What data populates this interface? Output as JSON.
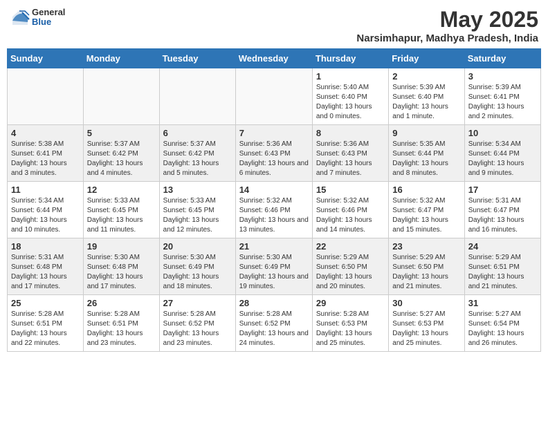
{
  "header": {
    "logo_general": "General",
    "logo_blue": "Blue",
    "month": "May 2025",
    "location": "Narsimhapur, Madhya Pradesh, India"
  },
  "weekdays": [
    "Sunday",
    "Monday",
    "Tuesday",
    "Wednesday",
    "Thursday",
    "Friday",
    "Saturday"
  ],
  "weeks": [
    [
      {
        "day": "",
        "info": ""
      },
      {
        "day": "",
        "info": ""
      },
      {
        "day": "",
        "info": ""
      },
      {
        "day": "",
        "info": ""
      },
      {
        "day": "1",
        "info": "Sunrise: 5:40 AM\nSunset: 6:40 PM\nDaylight: 13 hours and 0 minutes."
      },
      {
        "day": "2",
        "info": "Sunrise: 5:39 AM\nSunset: 6:40 PM\nDaylight: 13 hours and 1 minute."
      },
      {
        "day": "3",
        "info": "Sunrise: 5:39 AM\nSunset: 6:41 PM\nDaylight: 13 hours and 2 minutes."
      }
    ],
    [
      {
        "day": "4",
        "info": "Sunrise: 5:38 AM\nSunset: 6:41 PM\nDaylight: 13 hours and 3 minutes."
      },
      {
        "day": "5",
        "info": "Sunrise: 5:37 AM\nSunset: 6:42 PM\nDaylight: 13 hours and 4 minutes."
      },
      {
        "day": "6",
        "info": "Sunrise: 5:37 AM\nSunset: 6:42 PM\nDaylight: 13 hours and 5 minutes."
      },
      {
        "day": "7",
        "info": "Sunrise: 5:36 AM\nSunset: 6:43 PM\nDaylight: 13 hours and 6 minutes."
      },
      {
        "day": "8",
        "info": "Sunrise: 5:36 AM\nSunset: 6:43 PM\nDaylight: 13 hours and 7 minutes."
      },
      {
        "day": "9",
        "info": "Sunrise: 5:35 AM\nSunset: 6:44 PM\nDaylight: 13 hours and 8 minutes."
      },
      {
        "day": "10",
        "info": "Sunrise: 5:34 AM\nSunset: 6:44 PM\nDaylight: 13 hours and 9 minutes."
      }
    ],
    [
      {
        "day": "11",
        "info": "Sunrise: 5:34 AM\nSunset: 6:44 PM\nDaylight: 13 hours and 10 minutes."
      },
      {
        "day": "12",
        "info": "Sunrise: 5:33 AM\nSunset: 6:45 PM\nDaylight: 13 hours and 11 minutes."
      },
      {
        "day": "13",
        "info": "Sunrise: 5:33 AM\nSunset: 6:45 PM\nDaylight: 13 hours and 12 minutes."
      },
      {
        "day": "14",
        "info": "Sunrise: 5:32 AM\nSunset: 6:46 PM\nDaylight: 13 hours and 13 minutes."
      },
      {
        "day": "15",
        "info": "Sunrise: 5:32 AM\nSunset: 6:46 PM\nDaylight: 13 hours and 14 minutes."
      },
      {
        "day": "16",
        "info": "Sunrise: 5:32 AM\nSunset: 6:47 PM\nDaylight: 13 hours and 15 minutes."
      },
      {
        "day": "17",
        "info": "Sunrise: 5:31 AM\nSunset: 6:47 PM\nDaylight: 13 hours and 16 minutes."
      }
    ],
    [
      {
        "day": "18",
        "info": "Sunrise: 5:31 AM\nSunset: 6:48 PM\nDaylight: 13 hours and 17 minutes."
      },
      {
        "day": "19",
        "info": "Sunrise: 5:30 AM\nSunset: 6:48 PM\nDaylight: 13 hours and 17 minutes."
      },
      {
        "day": "20",
        "info": "Sunrise: 5:30 AM\nSunset: 6:49 PM\nDaylight: 13 hours and 18 minutes."
      },
      {
        "day": "21",
        "info": "Sunrise: 5:30 AM\nSunset: 6:49 PM\nDaylight: 13 hours and 19 minutes."
      },
      {
        "day": "22",
        "info": "Sunrise: 5:29 AM\nSunset: 6:50 PM\nDaylight: 13 hours and 20 minutes."
      },
      {
        "day": "23",
        "info": "Sunrise: 5:29 AM\nSunset: 6:50 PM\nDaylight: 13 hours and 21 minutes."
      },
      {
        "day": "24",
        "info": "Sunrise: 5:29 AM\nSunset: 6:51 PM\nDaylight: 13 hours and 21 minutes."
      }
    ],
    [
      {
        "day": "25",
        "info": "Sunrise: 5:28 AM\nSunset: 6:51 PM\nDaylight: 13 hours and 22 minutes."
      },
      {
        "day": "26",
        "info": "Sunrise: 5:28 AM\nSunset: 6:51 PM\nDaylight: 13 hours and 23 minutes."
      },
      {
        "day": "27",
        "info": "Sunrise: 5:28 AM\nSunset: 6:52 PM\nDaylight: 13 hours and 23 minutes."
      },
      {
        "day": "28",
        "info": "Sunrise: 5:28 AM\nSunset: 6:52 PM\nDaylight: 13 hours and 24 minutes."
      },
      {
        "day": "29",
        "info": "Sunrise: 5:28 AM\nSunset: 6:53 PM\nDaylight: 13 hours and 25 minutes."
      },
      {
        "day": "30",
        "info": "Sunrise: 5:27 AM\nSunset: 6:53 PM\nDaylight: 13 hours and 25 minutes."
      },
      {
        "day": "31",
        "info": "Sunrise: 5:27 AM\nSunset: 6:54 PM\nDaylight: 13 hours and 26 minutes."
      }
    ]
  ]
}
